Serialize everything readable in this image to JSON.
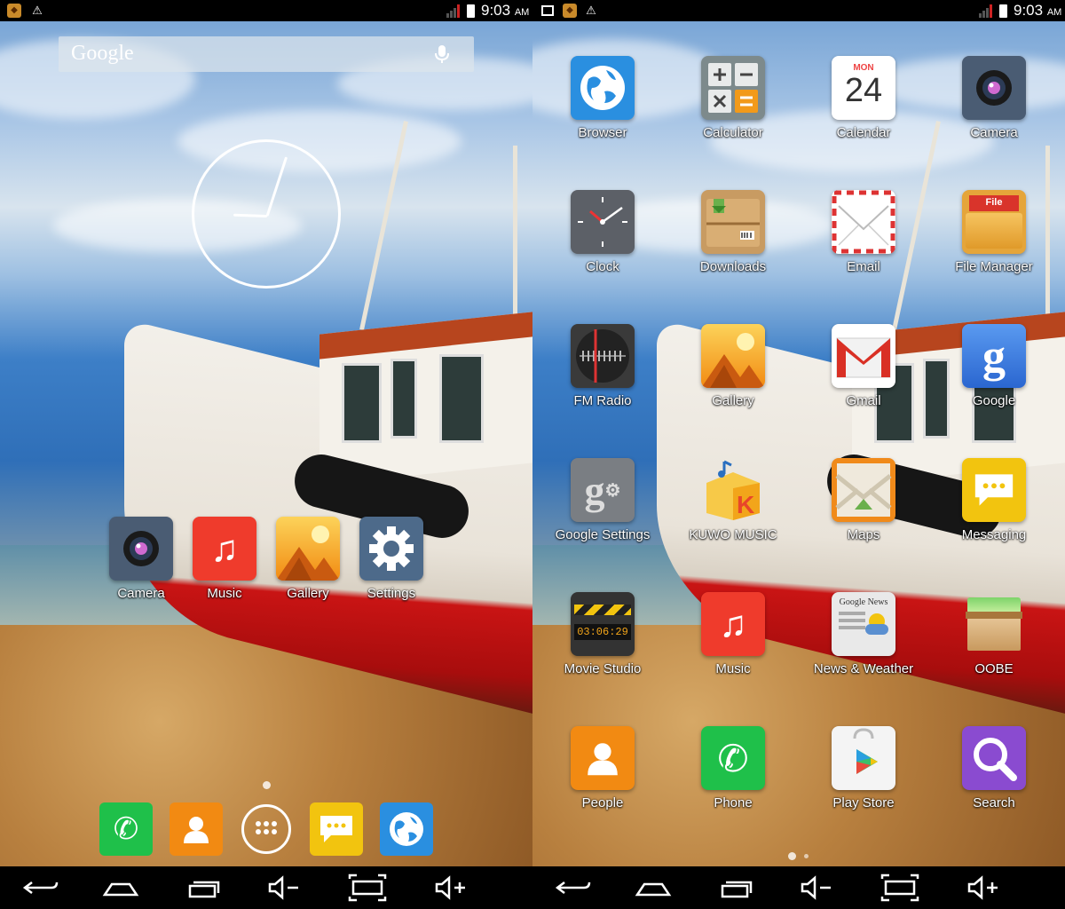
{
  "status_bar": {
    "time": "9:03",
    "ampm": "AM"
  },
  "home": {
    "search_logo": "Google",
    "favorites": [
      {
        "label": "Camera",
        "icon": "camera-icon"
      },
      {
        "label": "Music",
        "icon": "music-icon"
      },
      {
        "label": "Gallery",
        "icon": "gallery-icon"
      },
      {
        "label": "Settings",
        "icon": "settings-icon"
      }
    ],
    "dock": [
      {
        "icon": "phone-icon",
        "color": "#1fc04a"
      },
      {
        "icon": "people-icon",
        "color": "#f28a12"
      },
      {
        "icon": "all-apps-icon",
        "color": ""
      },
      {
        "icon": "messaging-icon",
        "color": "#f2c40f"
      },
      {
        "icon": "browser-icon",
        "color": "#2a8fe0"
      }
    ]
  },
  "drawer": {
    "apps": [
      {
        "label": "Browser",
        "icon": "browser-icon",
        "color": "#2a8fe0"
      },
      {
        "label": "Calculator",
        "icon": "calculator-icon",
        "color": "#7d8a8c"
      },
      {
        "label": "Calendar",
        "icon": "calendar-icon",
        "color": "#ffffff",
        "cal_month": "MON",
        "cal_day": "24"
      },
      {
        "label": "Camera",
        "icon": "camera-icon",
        "color": "#4a5c73"
      },
      {
        "label": "Clock",
        "icon": "clock-icon",
        "color": "#5c6067"
      },
      {
        "label": "Downloads",
        "icon": "downloads-icon",
        "color": "#c89b62"
      },
      {
        "label": "Email",
        "icon": "email-icon",
        "color": "#ffffff"
      },
      {
        "label": "File Manager",
        "icon": "file-manager-icon",
        "color": "#e5a53a",
        "badge": "File"
      },
      {
        "label": "FM Radio",
        "icon": "fm-radio-icon",
        "color": "#3a3a3a"
      },
      {
        "label": "Gallery",
        "icon": "gallery-icon",
        "color": "#f29a1a"
      },
      {
        "label": "Gmail",
        "icon": "gmail-icon",
        "color": "#ffffff"
      },
      {
        "label": "Google",
        "icon": "google-icon",
        "color": "#3a7de0"
      },
      {
        "label": "Google Settings",
        "icon": "google-settings-icon",
        "color": "#7a7e83"
      },
      {
        "label": "KUWO MUSIC",
        "icon": "kuwo-music-icon",
        "color": "#f2c23a"
      },
      {
        "label": "Maps",
        "icon": "maps-icon",
        "color": "#f08a1a"
      },
      {
        "label": "Messaging",
        "icon": "messaging-icon",
        "color": "#f2c40f"
      },
      {
        "label": "Movie Studio",
        "icon": "movie-studio-icon",
        "color": "#333333",
        "counter": "03:06:29"
      },
      {
        "label": "Music",
        "icon": "music-icon",
        "color": "#ef3b2c"
      },
      {
        "label": "News & Weather",
        "icon": "news-weather-icon",
        "color": "#e9e9e9",
        "masthead": "Google News"
      },
      {
        "label": "OOBE",
        "icon": "oobe-icon",
        "color": "#e8d2b0"
      },
      {
        "label": "People",
        "icon": "people-icon",
        "color": "#f28a12"
      },
      {
        "label": "Phone",
        "icon": "phone-icon",
        "color": "#1fc04a"
      },
      {
        "label": "Play Store",
        "icon": "play-store-icon",
        "color": "#f4f4f4"
      },
      {
        "label": "Search",
        "icon": "search-icon",
        "color": "#8a4bd0"
      }
    ]
  },
  "nav_buttons": [
    "back-icon",
    "home-icon",
    "recents-icon",
    "volume-down-icon",
    "screenshot-icon",
    "volume-up-icon"
  ]
}
